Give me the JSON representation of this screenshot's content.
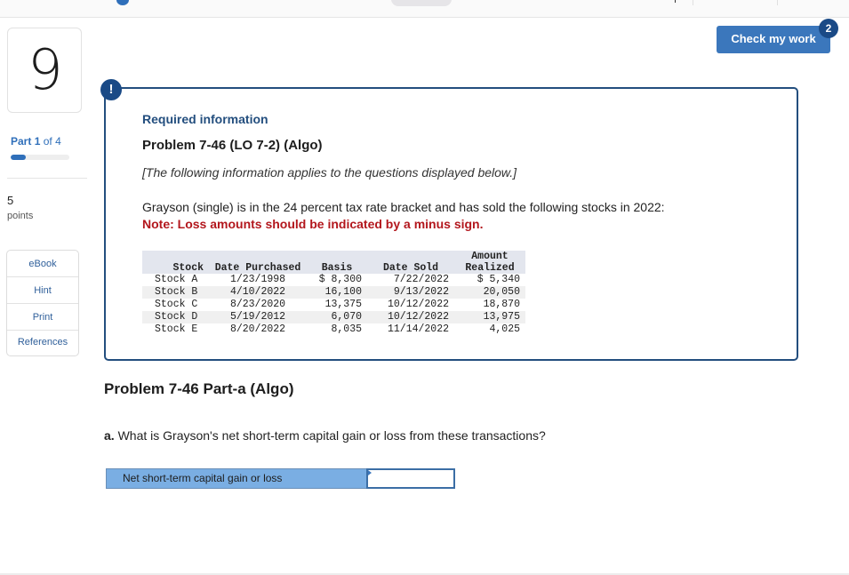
{
  "sidebar": {
    "question_number": "9",
    "part": {
      "prefix": "Part",
      "current": "1",
      "of_label": "of",
      "total": "4"
    },
    "progress_fraction": 0.25,
    "points_value": "5",
    "points_label": "points",
    "tools": [
      {
        "label": "eBook"
      },
      {
        "label": "Hint"
      },
      {
        "label": "Print"
      },
      {
        "label": "References"
      }
    ]
  },
  "header": {
    "check_button_label": "Check my work",
    "check_badge_count": "2"
  },
  "info": {
    "alert_icon_glyph": "!",
    "required_label": "Required information",
    "problem_title": "Problem 7-46 (LO 7-2) (Algo)",
    "applies_text": "[The following information applies to the questions displayed below.]",
    "scenario_text": "Grayson (single) is in the 24 percent tax rate bracket and has sold the following stocks in 2022:",
    "note_text": "Note: Loss amounts should be indicated by a minus sign.",
    "table": {
      "headers": [
        "Stock",
        "Date Purchased",
        "Basis",
        "Date Sold",
        "Amount\nRealized"
      ],
      "header_amount_line1": "Amount",
      "header_amount_line2": "Realized",
      "rows": [
        [
          "Stock A",
          "1/23/1998",
          "$ 8,300",
          "7/22/2022",
          "$ 5,340"
        ],
        [
          "Stock B",
          "4/10/2022",
          "16,100",
          "9/13/2022",
          "20,050"
        ],
        [
          "Stock C",
          "8/23/2020",
          "13,375",
          "10/12/2022",
          "18,870"
        ],
        [
          "Stock D",
          "5/19/2012",
          "6,070",
          "10/12/2022",
          "13,975"
        ],
        [
          "Stock E",
          "8/20/2022",
          "8,035",
          "11/14/2022",
          "4,025"
        ]
      ]
    }
  },
  "part_a": {
    "title": "Problem 7-46 Part-a (Algo)",
    "question_prefix": "a.",
    "question_text": " What is Grayson's net short-term capital gain or loss from these transactions?",
    "answer_label": "Net short-term capital gain or loss",
    "answer_value": ""
  },
  "colors": {
    "accent": "#3b77bc",
    "dark_accent": "#1a4a86",
    "note_red": "#b3171d",
    "answer_label_bg": "#7aaee3"
  }
}
